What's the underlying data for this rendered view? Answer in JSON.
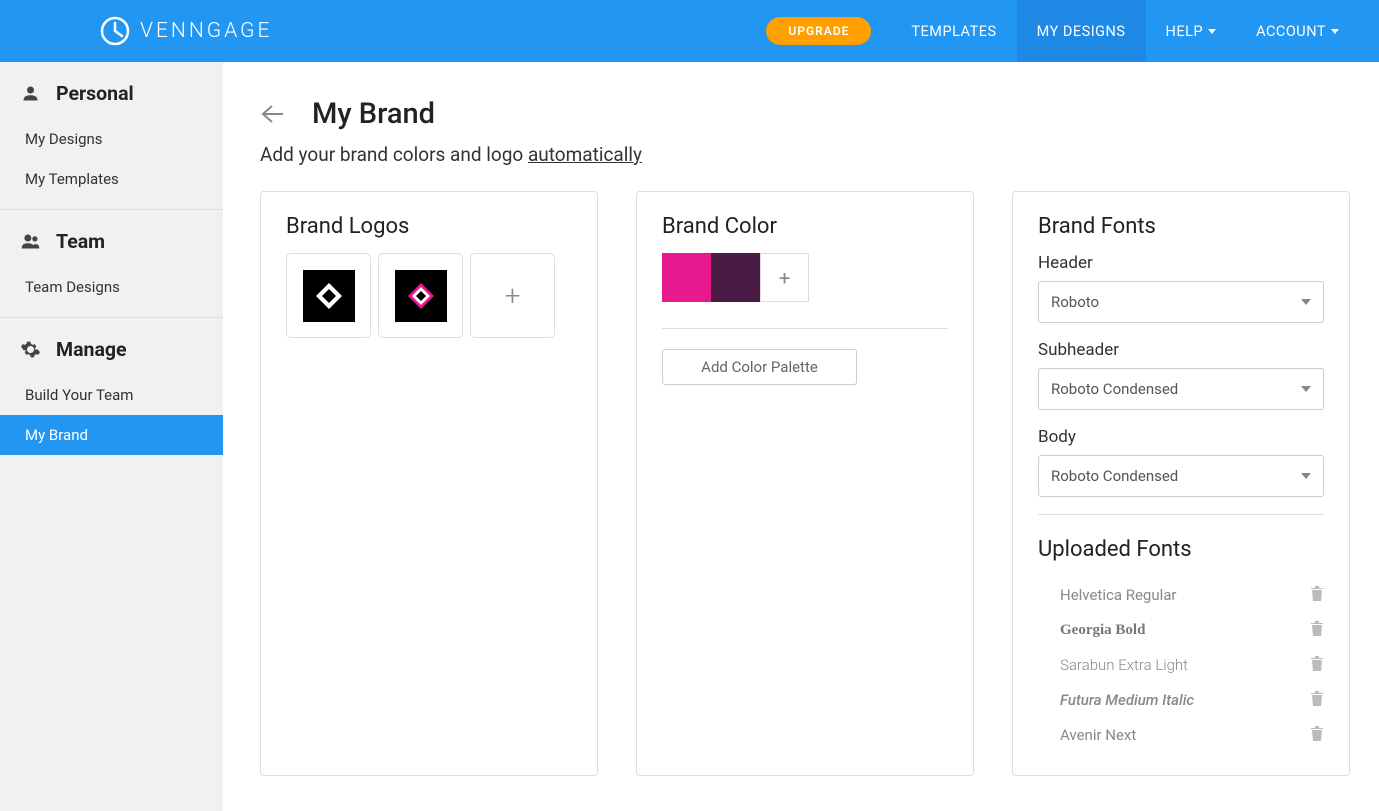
{
  "header": {
    "brand": "VENNGAGE",
    "upgrade": "UPGRADE",
    "nav": {
      "templates": "TEMPLATES",
      "mydesigns": "MY DESIGNS",
      "help": "HELP",
      "account": "ACCOUNT"
    }
  },
  "sidebar": {
    "personal": {
      "title": "Personal",
      "mydesigns": "My Designs",
      "mytemplates": "My Templates"
    },
    "team": {
      "title": "Team",
      "teamdesigns": "Team Designs"
    },
    "manage": {
      "title": "Manage",
      "buildteam": "Build Your Team",
      "mybrand": "My Brand"
    }
  },
  "page": {
    "title": "My Brand",
    "subtitle_pre": "Add your brand colors and logo ",
    "subtitle_link": "automatically"
  },
  "logos": {
    "title": "Brand Logos"
  },
  "colors": {
    "title": "Brand Color",
    "color1": "#e6198e",
    "color2": "#4a1b45",
    "add_palette": "Add Color Palette"
  },
  "fonts": {
    "title": "Brand Fonts",
    "header_label": "Header",
    "header_value": "Roboto",
    "sub_label": "Subheader",
    "sub_value": "Roboto Condensed",
    "body_label": "Body",
    "body_value": "Roboto Condensed",
    "uploaded_title": "Uploaded Fonts",
    "uploaded": {
      "f1": "Helvetica Regular",
      "f2": "Georgia Bold",
      "f3": "Sarabun Extra Light",
      "f4": "Futura Medium Italic",
      "f5": "Avenir Next"
    }
  }
}
